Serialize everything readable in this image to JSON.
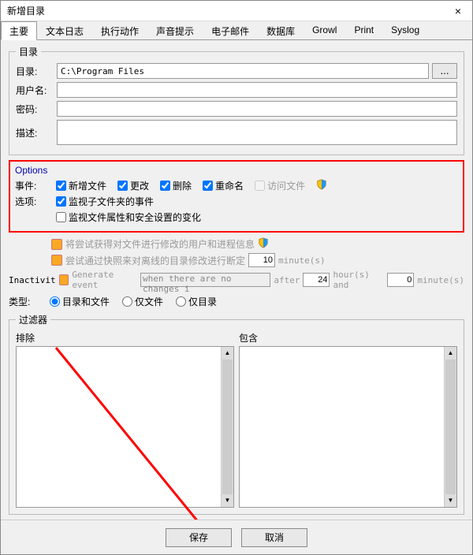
{
  "window": {
    "title": "新增目录",
    "close": "×"
  },
  "tabs": [
    "主要",
    "文本日志",
    "执行动作",
    "声音提示",
    "电子邮件",
    "数据库",
    "Growl",
    "Print",
    "Syslog"
  ],
  "active_tab": 0,
  "dir_section": {
    "legend": "目录",
    "dir_label": "目录:",
    "dir_value": "C:\\Program Files",
    "browse": "...",
    "user_label": "用户名:",
    "user_value": "",
    "pass_label": "密码:",
    "pass_value": "",
    "desc_label": "描述:",
    "desc_value": ""
  },
  "options": {
    "legend": "Options",
    "event_label": "事件:",
    "cb_new": "新增文件",
    "cb_change": "更改",
    "cb_delete": "删除",
    "cb_rename": "重命名",
    "cb_access": "访问文件",
    "opt_label": "选项:",
    "cb_watchsub": "监视子文件夹的事件",
    "cb_watchattr": "监视文件属性和安全设置的变化",
    "disabled1": "将尝试获得对文件进行修改的用户和进程信息",
    "disabled2_a": "尝试通过快照来对离线的目录修改进行断定",
    "disabled2_val": "10",
    "disabled2_unit": "minute(s)",
    "inactivity_label": "Inactivit",
    "inact_gen": "Generate event",
    "inact_dd": "when there are no changes i",
    "inact_after": "after",
    "inact_h": "24",
    "inact_hunit": "hour(s) and",
    "inact_m": "0",
    "inact_munit": "minute(s)",
    "type_label": "类型:",
    "radio_both": "目录和文件",
    "radio_file": "仅文件",
    "radio_dir": "仅目录"
  },
  "filter": {
    "legend": "过滤器",
    "exclude": "排除",
    "include": "包含"
  },
  "footer": {
    "save": "保存",
    "cancel": "取消"
  }
}
